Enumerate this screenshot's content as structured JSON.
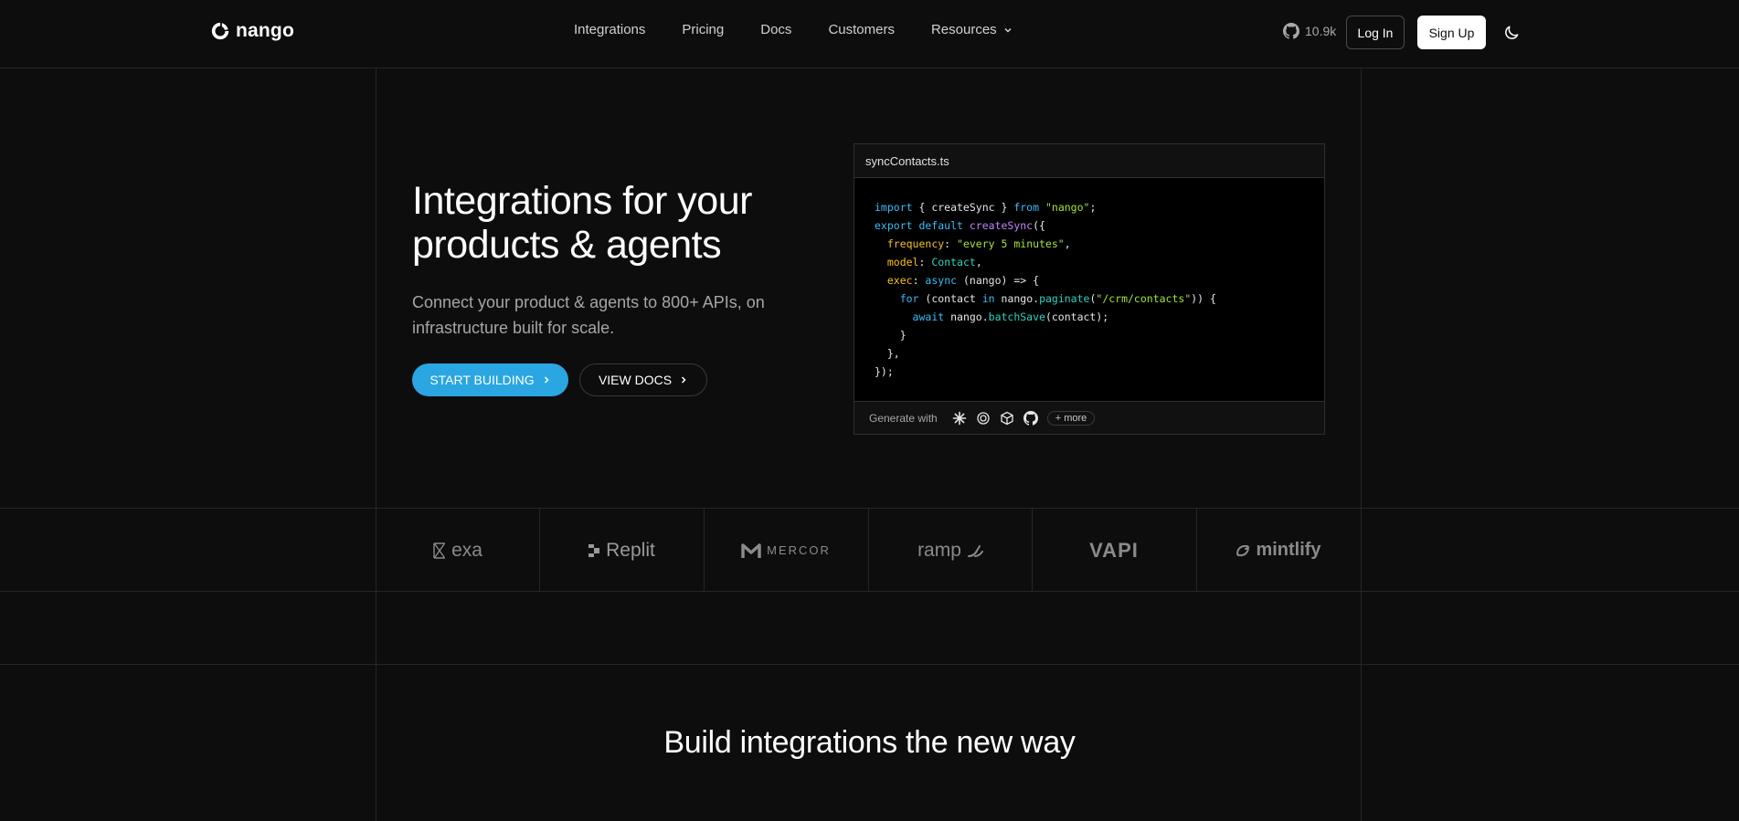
{
  "brand": {
    "name": "nango"
  },
  "nav": {
    "items": [
      {
        "label": "Integrations"
      },
      {
        "label": "Pricing"
      },
      {
        "label": "Docs"
      },
      {
        "label": "Customers"
      },
      {
        "label": "Resources"
      }
    ]
  },
  "header": {
    "github_stars": "10.9k",
    "login_label": "Log In",
    "signup_label": "Sign Up"
  },
  "hero": {
    "title_line1": "Integrations for your",
    "title_line2": "products & agents",
    "subtitle_line1": "Connect your product & agents to 800+ APIs, on",
    "subtitle_line2": "infrastructure built for scale.",
    "primary_cta": "START BUILDING",
    "secondary_cta": "VIEW DOCS"
  },
  "code_card": {
    "filename": "syncContacts.ts",
    "generate_label": "Generate with",
    "more_label": "+ more"
  },
  "customers": [
    {
      "name": "exa"
    },
    {
      "name": "Replit"
    },
    {
      "name": "MERCOR"
    },
    {
      "name": "ramp"
    },
    {
      "name": "VAPI"
    },
    {
      "name": "mintlify"
    }
  ],
  "section": {
    "heading": "Build integrations the new way"
  },
  "colors": {
    "accent": "#2aa6e2",
    "background": "#0d0d0d"
  }
}
